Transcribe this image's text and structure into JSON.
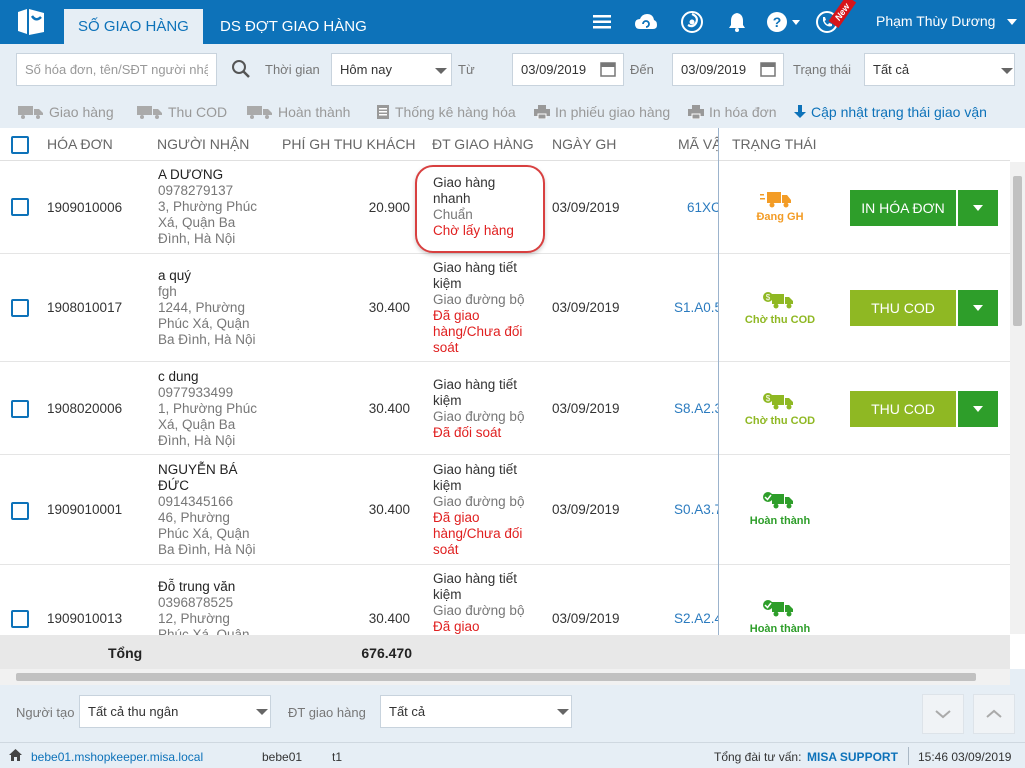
{
  "topbar": {
    "tabs": [
      {
        "label": "SỐ GIAO HÀNG"
      },
      {
        "label": "DS ĐỢT GIAO HÀNG"
      }
    ],
    "new_badge": "New",
    "user_name": "Phạm Thùy Dương"
  },
  "filters": {
    "search_placeholder": "Số hóa đơn, tên/SĐT người nhận",
    "time_label": "Thời gian",
    "time_value": "Hôm nay",
    "from_label": "Từ",
    "from_date": "03/09/2019",
    "to_label": "Đến",
    "to_date": "03/09/2019",
    "status_label": "Trạng thái",
    "status_value": "Tất cả"
  },
  "toolbar": [
    {
      "label": "Giao hàng"
    },
    {
      "label": "Thu COD"
    },
    {
      "label": "Hoàn thành"
    },
    {
      "label": "Thống kê hàng hóa"
    },
    {
      "label": "In phiếu giao hàng"
    },
    {
      "label": "In hóa đơn"
    },
    {
      "label": "Cập nhật trạng thái giao vận"
    }
  ],
  "columns": [
    "HÓA ĐƠN",
    "NGƯỜI NHẬN",
    "PHÍ GH THU KHÁCH",
    "ĐT GIAO HÀNG",
    "NGÀY GH",
    "MÃ VẬ",
    "TRẠNG THÁI"
  ],
  "rows": [
    {
      "invoice": "1909010006",
      "name": "A DƯƠNG",
      "phone": "0978279137",
      "addr": [
        "3, Phường Phúc",
        "Xá, Quận Ba",
        "Đình, Hà Nội"
      ],
      "fee": "20.900",
      "carrier": [
        "Giao hàng",
        "nhanh"
      ],
      "service": [
        "Chuẩn"
      ],
      "carrier_status": [
        "Chờ lấy hàng"
      ],
      "date": "03/09/2019",
      "code": "61XC",
      "status": "Đang GH",
      "status_color": "#f39c26",
      "action": "IN HÓA ĐƠN",
      "action_color": "#2e9e2a"
    },
    {
      "invoice": "1908010017",
      "name": "a quý",
      "phone": "fgh",
      "addr": [
        "1244, Phường",
        "Phúc Xá, Quận",
        "Ba Đình, Hà Nội"
      ],
      "fee": "30.400",
      "carrier": [
        "Giao hàng tiết",
        "kiệm"
      ],
      "service": [
        "Giao đường bộ"
      ],
      "carrier_status": [
        "Đã giao",
        "hàng/Chưa đối",
        "soát"
      ],
      "date": "03/09/2019",
      "code": "S1.A0.5",
      "status": "Chờ thu COD",
      "status_color": "#8fb823",
      "action": "THU COD",
      "action_color": "#8fb823"
    },
    {
      "invoice": "1908020006",
      "name": "c dung",
      "phone": "0977933499",
      "addr": [
        "1, Phường Phúc",
        "Xá, Quận Ba",
        "Đình, Hà Nội"
      ],
      "fee": "30.400",
      "carrier": [
        "Giao hàng tiết",
        "kiệm"
      ],
      "service": [
        "Giao đường bộ"
      ],
      "carrier_status": [
        "Đã đối soát"
      ],
      "date": "03/09/2019",
      "code": "S8.A2.3",
      "status": "Chờ thu COD",
      "status_color": "#8fb823",
      "action": "THU COD",
      "action_color": "#8fb823"
    },
    {
      "invoice": "1909010001",
      "name": "NGUYỄN BÁ",
      "name2": "ĐỨC",
      "phone": "0914345166",
      "addr": [
        "46, Phường",
        "Phúc Xá, Quận",
        "Ba Đình, Hà Nội"
      ],
      "fee": "30.400",
      "carrier": [
        "Giao hàng tiết",
        "kiệm"
      ],
      "service": [
        "Giao đường bộ"
      ],
      "carrier_status": [
        "Đã giao",
        "hàng/Chưa đối",
        "soát"
      ],
      "date": "03/09/2019",
      "code": "S0.A3.7",
      "status": "Hoàn thành",
      "status_color": "#2e9e2a"
    },
    {
      "invoice": "1909010013",
      "name": "Đỗ trung văn",
      "phone": "0396878525",
      "addr": [
        "12, Phường",
        "Phúc Xá, Quận"
      ],
      "fee": "30.400",
      "carrier": [
        "Giao hàng tiết",
        "kiệm"
      ],
      "service": [
        "Giao đường bộ"
      ],
      "carrier_status": [
        "Đã giao"
      ],
      "date": "03/09/2019",
      "code": "S2.A2.4",
      "status": "Hoàn thành",
      "status_color": "#2e9e2a"
    }
  ],
  "total": {
    "label": "Tổng",
    "value": "676.470"
  },
  "bottom_filters": {
    "creator_label": "Người tạo",
    "creator_value": "Tất cả thu ngân",
    "carrier_label": "ĐT giao hàng",
    "carrier_value": "Tất cả"
  },
  "statusbar": {
    "domain": "bebe01.mshopkeeper.misa.local",
    "shop": "bebe01",
    "branch": "t1",
    "hotline_label": "Tổng đài tư vấn:",
    "hotline": "MISA SUPPORT",
    "datetime": "15:46 03/09/2019"
  },
  "colors": {
    "primary": "#0d72b9",
    "panel": "#e6eef5",
    "link": "#2b7bbf",
    "danger": "#e02020"
  }
}
